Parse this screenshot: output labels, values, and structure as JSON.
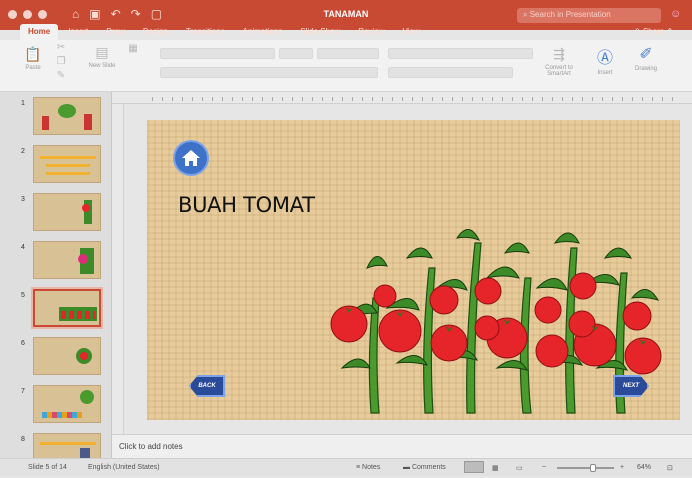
{
  "window": {
    "title": "TANAMAN",
    "search_placeholder": "Search in Presentation"
  },
  "tabs": [
    {
      "label": "Home",
      "active": true
    },
    {
      "label": "Insert",
      "active": false
    },
    {
      "label": "Draw",
      "active": false
    },
    {
      "label": "Design",
      "active": false
    },
    {
      "label": "Transitions",
      "active": false
    },
    {
      "label": "Animations",
      "active": false
    },
    {
      "label": "Slide Show",
      "active": false
    },
    {
      "label": "Review",
      "active": false
    },
    {
      "label": "View",
      "active": false
    }
  ],
  "share_label": "Share",
  "ribbon": {
    "paste": "Paste",
    "new_slide": "New Slide",
    "convert": "Convert to SmartArt",
    "insert": "Insert",
    "drawing": "Drawing"
  },
  "thumbnails": [
    {
      "num": "1",
      "selected": false
    },
    {
      "num": "2",
      "selected": false
    },
    {
      "num": "3",
      "selected": false
    },
    {
      "num": "4",
      "selected": false
    },
    {
      "num": "5",
      "selected": true
    },
    {
      "num": "6",
      "selected": false
    },
    {
      "num": "7",
      "selected": false
    },
    {
      "num": "8",
      "selected": false
    }
  ],
  "slide": {
    "title": "BUAH TOMAT",
    "back_label": "BACK",
    "next_label": "NEXT"
  },
  "notes_placeholder": "Click to add notes",
  "status": {
    "slide_info": "Slide 5 of 14",
    "language": "English (United States)",
    "notes": "Notes",
    "comments": "Comments",
    "zoom": "64%",
    "zoom_level": 0.64
  },
  "colors": {
    "accent": "#c94a32",
    "slide_bg": "#e7cb9b",
    "button_blue": "#2a4a9a",
    "tomato": "#e5252a",
    "leaf": "#3d8a28"
  }
}
